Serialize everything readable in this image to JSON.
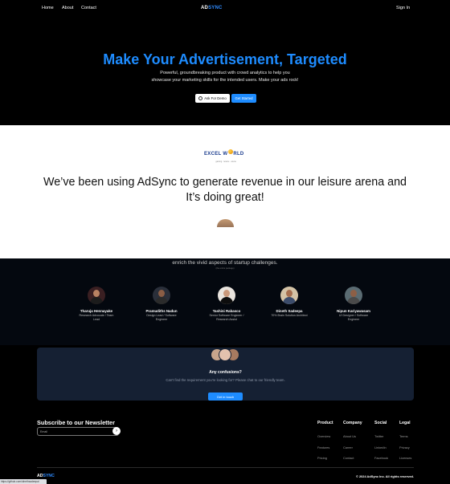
{
  "nav": {
    "links": [
      "Home",
      "About",
      "Contact"
    ],
    "logo_ad": "AD",
    "logo_sync": "SYNC",
    "sign_in": "Sign In"
  },
  "hero": {
    "title": "Make Your Advertisement, Targeted",
    "subtitle_line1": "Powerful, groundbreaking product with crowd analytics to help you",
    "subtitle_line2": "showcase your marketing skills for the intended users. Make your ads rock!",
    "demo_button": "Ask For Demo",
    "start_button": "Get Started"
  },
  "testimonial": {
    "logo_text_left": "EXCEL W",
    "logo_text_right": "RLD",
    "logo_tagline": "gaming · leisure · arena",
    "quote_line1": "We’ve been using AdSync to generate revenue in our leisure arena and",
    "quote_line2": "It’s doing great!"
  },
  "team": {
    "intro": "enrich the vivid aspects of startup challenges.",
    "intro_sub": "(the entire package)",
    "members": [
      {
        "name": "Tharuja Hennayake",
        "role_line1": "Research Advocate / Team",
        "role_line2": "Lead"
      },
      {
        "name": "Pramudiths Nadun",
        "role_line1": "Design Lead / Software",
        "role_line2": "Engineer"
      },
      {
        "name": "Tashini Rabasco",
        "role_line1": "Senior Software Engineer /",
        "role_line2": "Research Assist"
      },
      {
        "name": "Dineth Sadeepa",
        "role_line1": "70% Brain Solution Architect",
        "role_line2": ""
      },
      {
        "name": "Nipun Kariyawasam",
        "role_line1": "UI Designer / Software",
        "role_line2": "Engineer"
      }
    ]
  },
  "contact_card": {
    "heading": "Any confusions?",
    "text": "Can't find the requirement you're looking for? Please chat to our friendly team.",
    "button": "Get in touch"
  },
  "newsletter": {
    "title": "Subscribe to our Newsletter",
    "placeholder": "Email",
    "submit_glyph": "›"
  },
  "footer": {
    "columns": [
      {
        "heading": "Product",
        "links": [
          "Overview",
          "Features",
          "Pricing"
        ]
      },
      {
        "heading": "Company",
        "links": [
          "About Us",
          "Career",
          "Contact"
        ]
      },
      {
        "heading": "Social",
        "links": [
          "Twitter",
          "LinkedIn",
          "Facebook"
        ]
      },
      {
        "heading": "Legal",
        "links": [
          "Terms",
          "Privacy",
          "Licenses"
        ]
      }
    ],
    "logo_ad": "AD",
    "logo_sync": "SYNC",
    "copyright": "© 2024 AdSync Inc. All rights reserved."
  },
  "status_bar_url": "https://github.com/dinethsadeepa/",
  "colors": {
    "accent": "#1e8cff",
    "card_bg": "#152033",
    "page_bg": "#000000"
  }
}
